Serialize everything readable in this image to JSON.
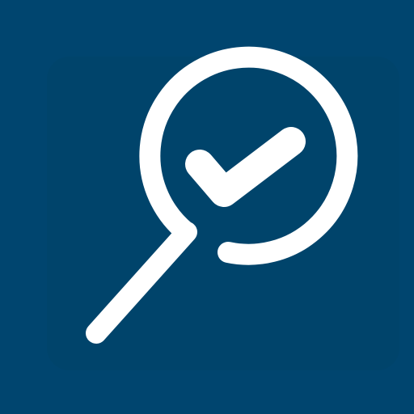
{
  "icon": {
    "name": "search-check-icon",
    "background_color": "#00456f",
    "glyph_color": "#ffffff"
  }
}
